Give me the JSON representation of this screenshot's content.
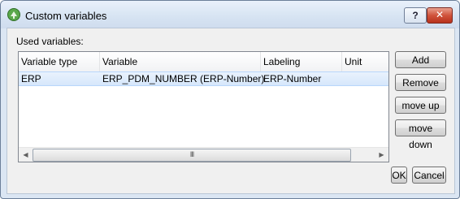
{
  "window": {
    "title": "Custom variables",
    "help_label": "?",
    "close_label": "✕"
  },
  "used_variables_label": "Used variables:",
  "table": {
    "columns": [
      "Variable type",
      "Variable",
      "Labeling",
      "Unit"
    ],
    "rows": [
      {
        "type": "ERP",
        "variable": "ERP_PDM_NUMBER (ERP-Number)",
        "labeling": "ERP-Number",
        "unit": ""
      }
    ],
    "scroll_thumb": "III"
  },
  "buttons": {
    "add": "Add",
    "remove": "Remove",
    "move_up": "move up",
    "move_down": "move down",
    "ok": "OK",
    "cancel": "Cancel"
  },
  "icons": {
    "app": "custom-variables-app-icon",
    "scroll_left": "◀",
    "scroll_right": "▶"
  }
}
